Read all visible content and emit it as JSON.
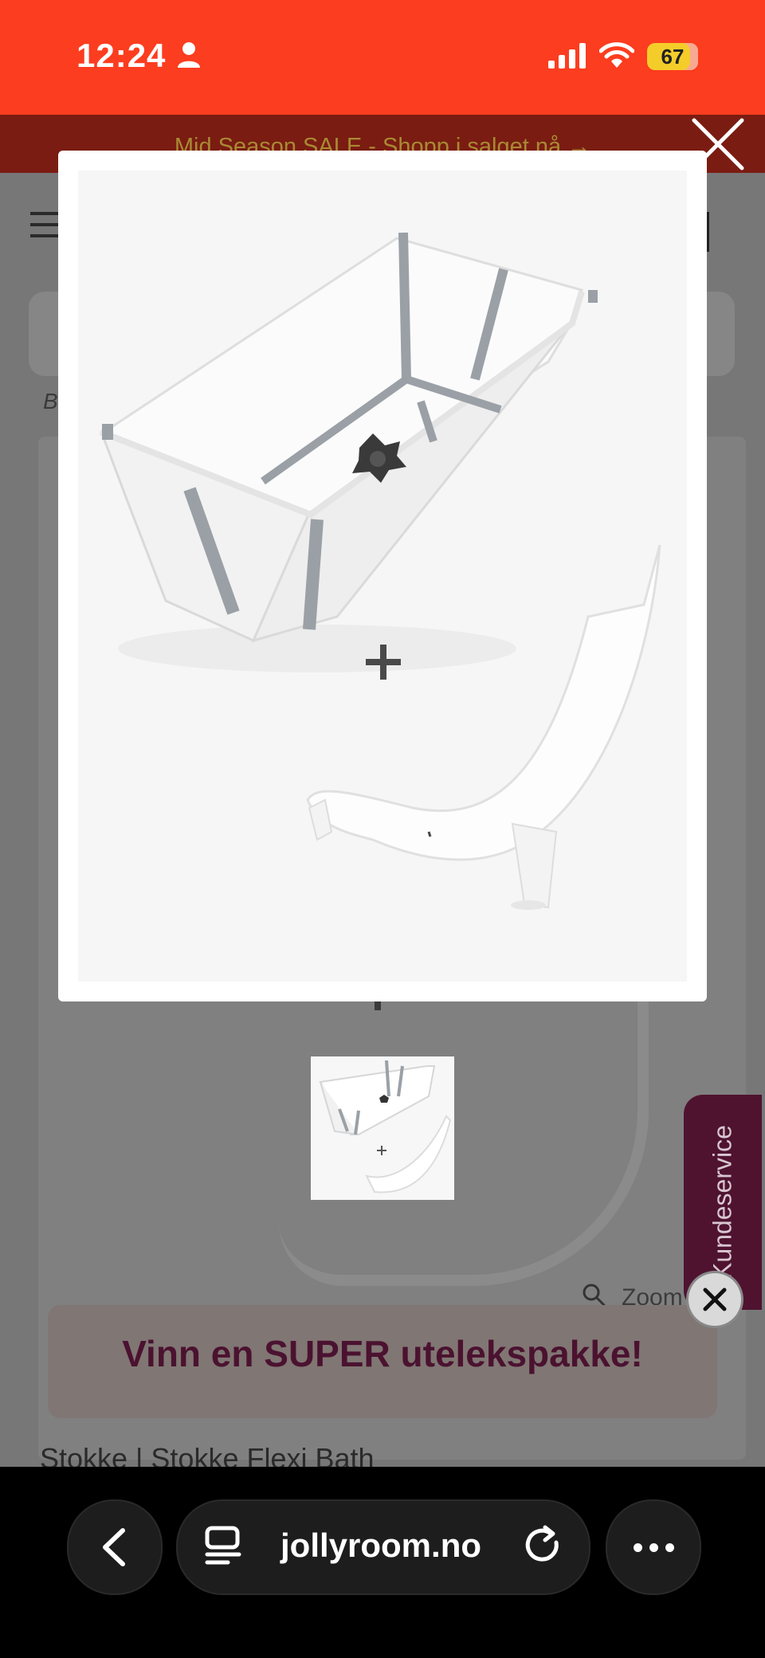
{
  "status_bar": {
    "time": "12:24",
    "battery": "67"
  },
  "promo_bar": {
    "text": "Mid Season SALE - Shopp i salget nå →"
  },
  "breadcrumb": {
    "first_letter": "B"
  },
  "zoom": {
    "label": "Zoom"
  },
  "kundeservice": {
    "label": "Kundeservice"
  },
  "promo_banner": {
    "text": "Vinn en SUPER utelekspakke!"
  },
  "product": {
    "title": "Stokke | Stokke Flexi Bath"
  },
  "browser": {
    "url": "jollyroom.no"
  },
  "colors": {
    "status_bar": "#fc3d1f",
    "brand_purple": "#4b1230",
    "browser_bar": "#000000"
  },
  "icons": [
    "person-icon",
    "signal-icon",
    "wifi-icon",
    "close-icon",
    "hamburger-icon",
    "search-icon",
    "back-icon",
    "reader-icon",
    "reload-icon",
    "more-icon"
  ]
}
